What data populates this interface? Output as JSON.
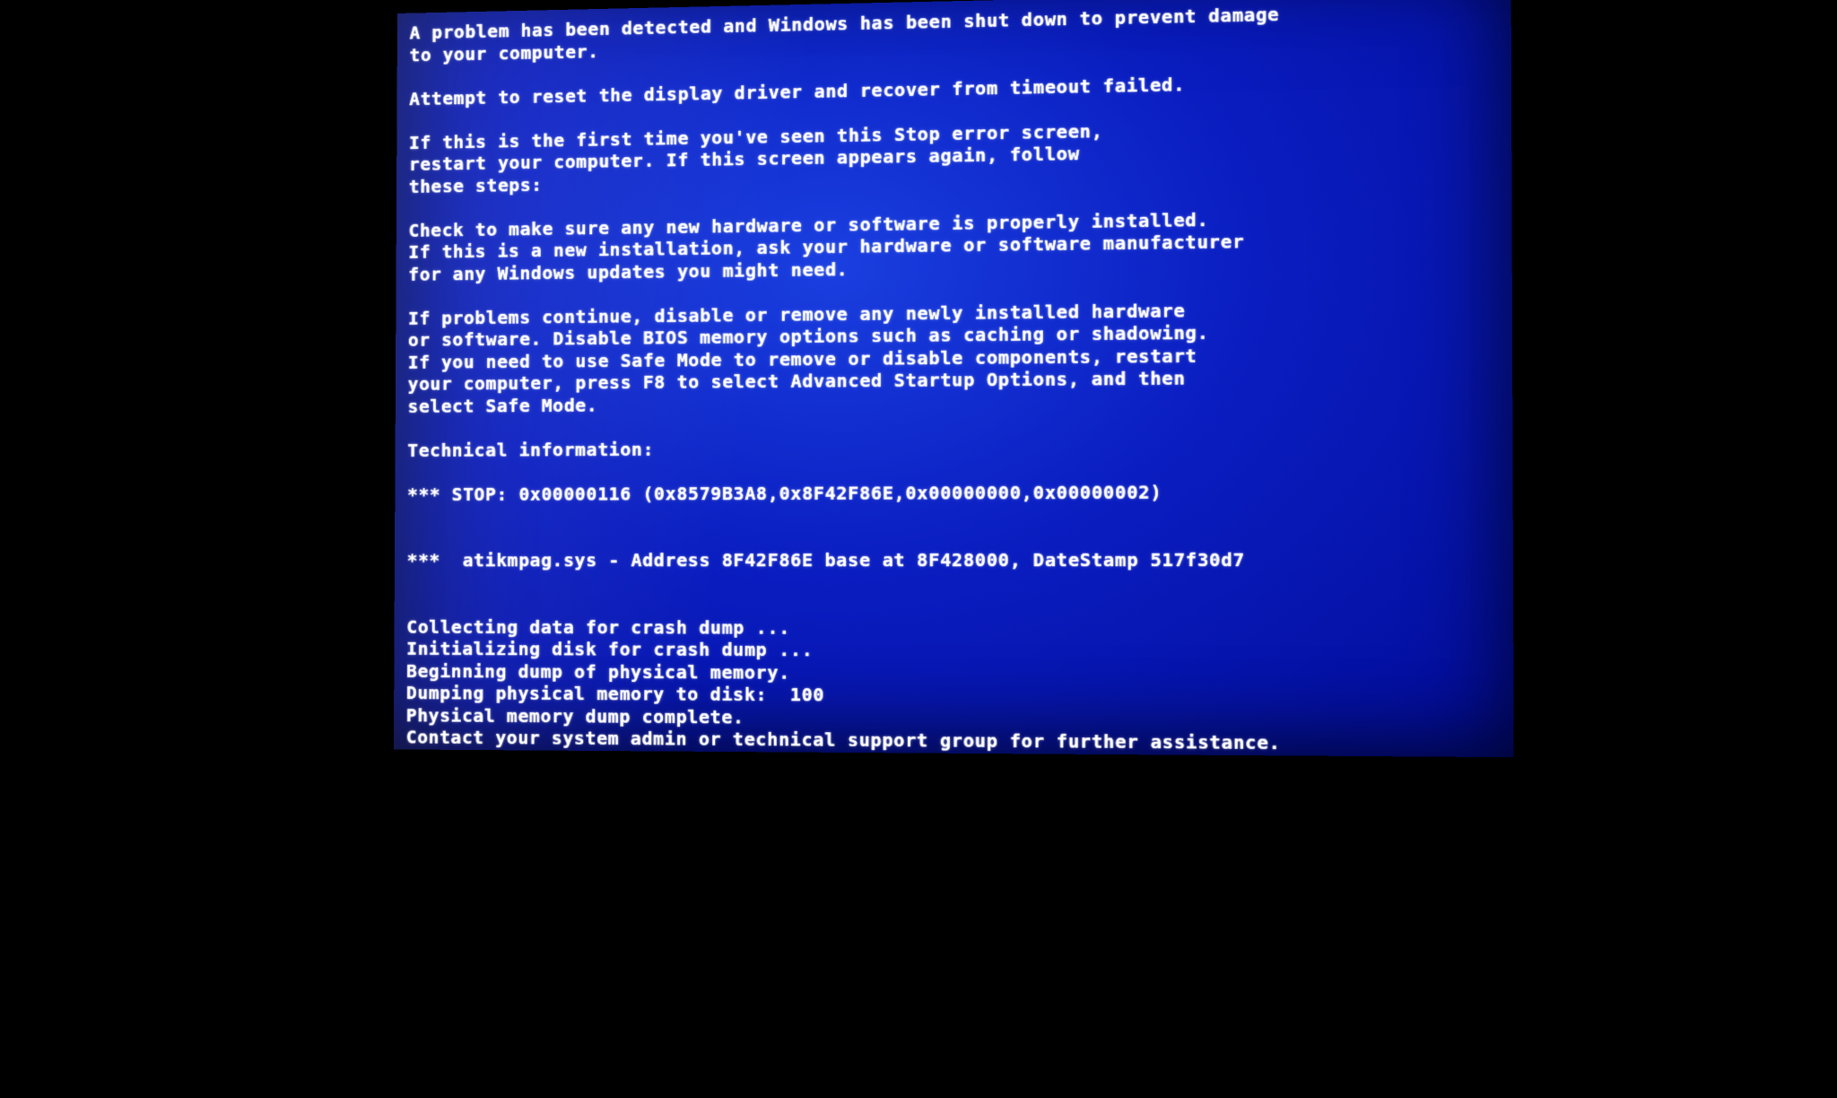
{
  "bsod": {
    "intro": "A problem has been detected and Windows has been shut down to prevent damage\nto your computer.",
    "error_message": "Attempt to reset the display driver and recover from timeout failed.",
    "first_time": "If this is the first time you've seen this Stop error screen,\nrestart your computer. If this screen appears again, follow\nthese steps:",
    "check_hw": "Check to make sure any new hardware or software is properly installed.\nIf this is a new installation, ask your hardware or software manufacturer\nfor any Windows updates you might need.",
    "if_problems": "If problems continue, disable or remove any newly installed hardware\nor software. Disable BIOS memory options such as caching or shadowing.\nIf you need to use Safe Mode to remove or disable components, restart\nyour computer, press F8 to select Advanced Startup Options, and then\nselect Safe Mode.",
    "tech_header": "Technical information:",
    "stop_line": "*** STOP: 0x00000116 (0x8579B3A8,0x8F42F86E,0x00000000,0x00000002)",
    "module_line": "***  atikmpag.sys - Address 8F42F86E base at 8F428000, DateStamp 517f30d7",
    "dump1": "Collecting data for crash dump ...",
    "dump2": "Initializing disk for crash dump ...",
    "dump3": "Beginning dump of physical memory.",
    "dump4": "Dumping physical memory to disk:  100",
    "dump5": "Physical memory dump complete.",
    "contact": "Contact your system admin or technical support group for further assistance."
  }
}
